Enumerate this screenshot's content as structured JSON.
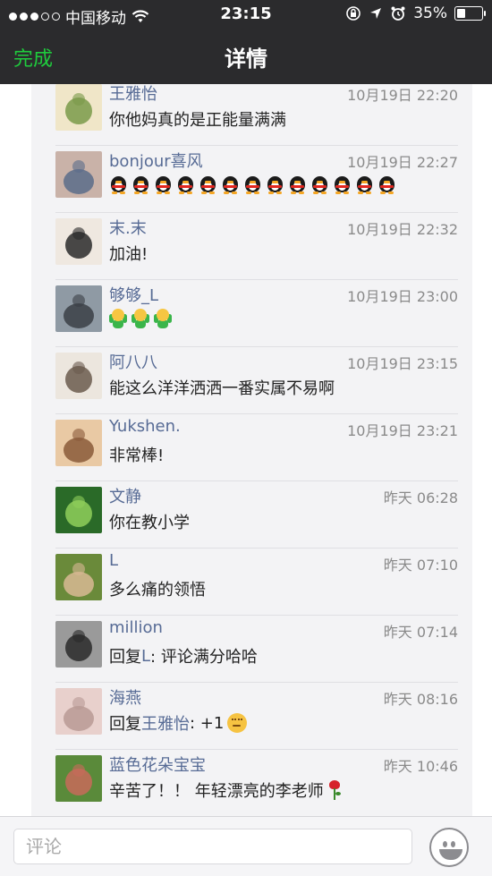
{
  "status_bar": {
    "carrier": "中国移动",
    "time": "23:15",
    "battery_text": "35%",
    "battery_level": 0.35
  },
  "nav": {
    "done_label": "完成",
    "title": "详情"
  },
  "comments": [
    {
      "name": "王雅怡",
      "time": "10月19日 22:20",
      "text": "你他妈真的是正能量满满",
      "avatar_colors": [
        "#f0e6c8",
        "#7a9a4a"
      ]
    },
    {
      "name": "bonjour喜风",
      "time": "10月19日 22:27",
      "text": "",
      "emoji": "penguin",
      "emoji_count": 13,
      "avatar_colors": [
        "#c9b2a8",
        "#5a6c8a"
      ]
    },
    {
      "name": "末.末",
      "time": "10月19日 22:32",
      "text": "加油!",
      "avatar_colors": [
        "#efe8e0",
        "#2a2a2a"
      ]
    },
    {
      "name": "够够_L",
      "time": "10月19日 23:00",
      "text": "",
      "emoji": "cheer",
      "emoji_count": 3,
      "avatar_colors": [
        "#8f9aa4",
        "#3b4046"
      ]
    },
    {
      "name": "阿八八",
      "time": "10月19日 23:15",
      "text": "能这么洋洋洒洒一番实属不易啊",
      "avatar_colors": [
        "#ece6de",
        "#6b5a4e"
      ]
    },
    {
      "name": "Yukshen.",
      "time": "10月19日 23:21",
      "text": "非常棒!",
      "avatar_colors": [
        "#e9c9a4",
        "#8a5a3a"
      ]
    },
    {
      "name": "文静",
      "time": "昨天 06:28",
      "text": "你在教小学",
      "avatar_colors": [
        "#2a6a28",
        "#8fcf5a"
      ]
    },
    {
      "name": "L",
      "time": "昨天 07:10",
      "text": "多么痛的领悟",
      "avatar_colors": [
        "#6a8a3a",
        "#d8b894"
      ]
    },
    {
      "name": "million",
      "time": "昨天 07:14",
      "reply_prefix": "回复",
      "reply_to": "L",
      "reply_text": ": 评论满分哈哈",
      "avatar_colors": [
        "#9a9a9a",
        "#2a2a2a"
      ]
    },
    {
      "name": "海燕",
      "time": "昨天 08:16",
      "reply_prefix": "回复",
      "reply_to": "王雅怡",
      "reply_text": ": +1",
      "reply_emoji": "think",
      "avatar_colors": [
        "#e8d0cc",
        "#b89a94"
      ]
    },
    {
      "name": "蓝色花朵宝宝",
      "time": "昨天 10:46",
      "text": "辛苦了！！ 年轻漂亮的李老师",
      "emoji_after": "rose",
      "avatar_colors": [
        "#5a8a3a",
        "#c86a5a"
      ]
    }
  ],
  "input_bar": {
    "placeholder": "评论"
  }
}
